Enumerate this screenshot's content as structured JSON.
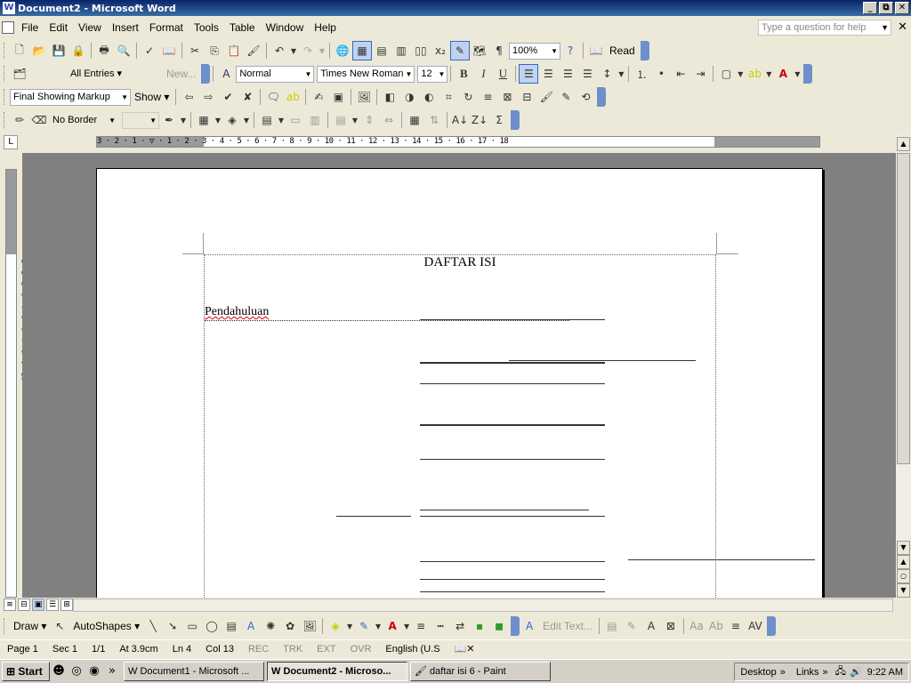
{
  "window": {
    "title": "Document2 - Microsoft Word",
    "minimize": "_",
    "restore": "⧉",
    "close": "✕"
  },
  "menu": {
    "items": [
      "File",
      "Edit",
      "View",
      "Insert",
      "Format",
      "Tools",
      "Table",
      "Window",
      "Help"
    ],
    "ask_placeholder": "Type a question for help",
    "doc_close": "✕"
  },
  "standard_toolbar": {
    "zoom": "100%",
    "read_label": "Read"
  },
  "formatting_toolbar": {
    "entries": "All Entries",
    "new_label": "New...",
    "style": "Normal",
    "font": "Times New Roman",
    "size": "12",
    "bold": "B",
    "italic": "I",
    "underline": "U"
  },
  "reviewing_toolbar": {
    "markup": "Final Showing Markup",
    "show": "Show"
  },
  "tables_toolbar": {
    "border": "No Border",
    "sum": "Σ"
  },
  "ruler": {
    "corner": "L",
    "ticks": "3 · 2 · 1 · ▽ · 1 · 2 · 3 · 4 · 5 · 6 · 7 · 8 · 9 · 10 · 11 · 12 · 13 · 14 · 15 · 16 · 17 · 18",
    "vticks": "1 · 1 · 2 · 3 · 4 · 5 · 6 · 7 · 8 · 9 · 10"
  },
  "document": {
    "title": "DAFTAR ISI",
    "entry": "Pendahuluan"
  },
  "drawing_toolbar": {
    "draw": "Draw",
    "autoshapes": "AutoShapes",
    "edit_text": "Edit Text..."
  },
  "status": {
    "page": "Page  1",
    "sec": "Sec  1",
    "pages": "1/1",
    "at": "At  3.9cm",
    "ln": "Ln  4",
    "col": "Col  13",
    "rec": "REC",
    "trk": "TRK",
    "ext": "EXT",
    "ovr": "OVR",
    "lang": "English (U.S"
  },
  "taskbar": {
    "start": "Start",
    "tasks": [
      "Document1 - Microsoft ...",
      "Document2 - Microso...",
      "daftar isi 6 - Paint"
    ],
    "desktop": "Desktop",
    "links": "Links",
    "clock": "9:22 AM"
  }
}
